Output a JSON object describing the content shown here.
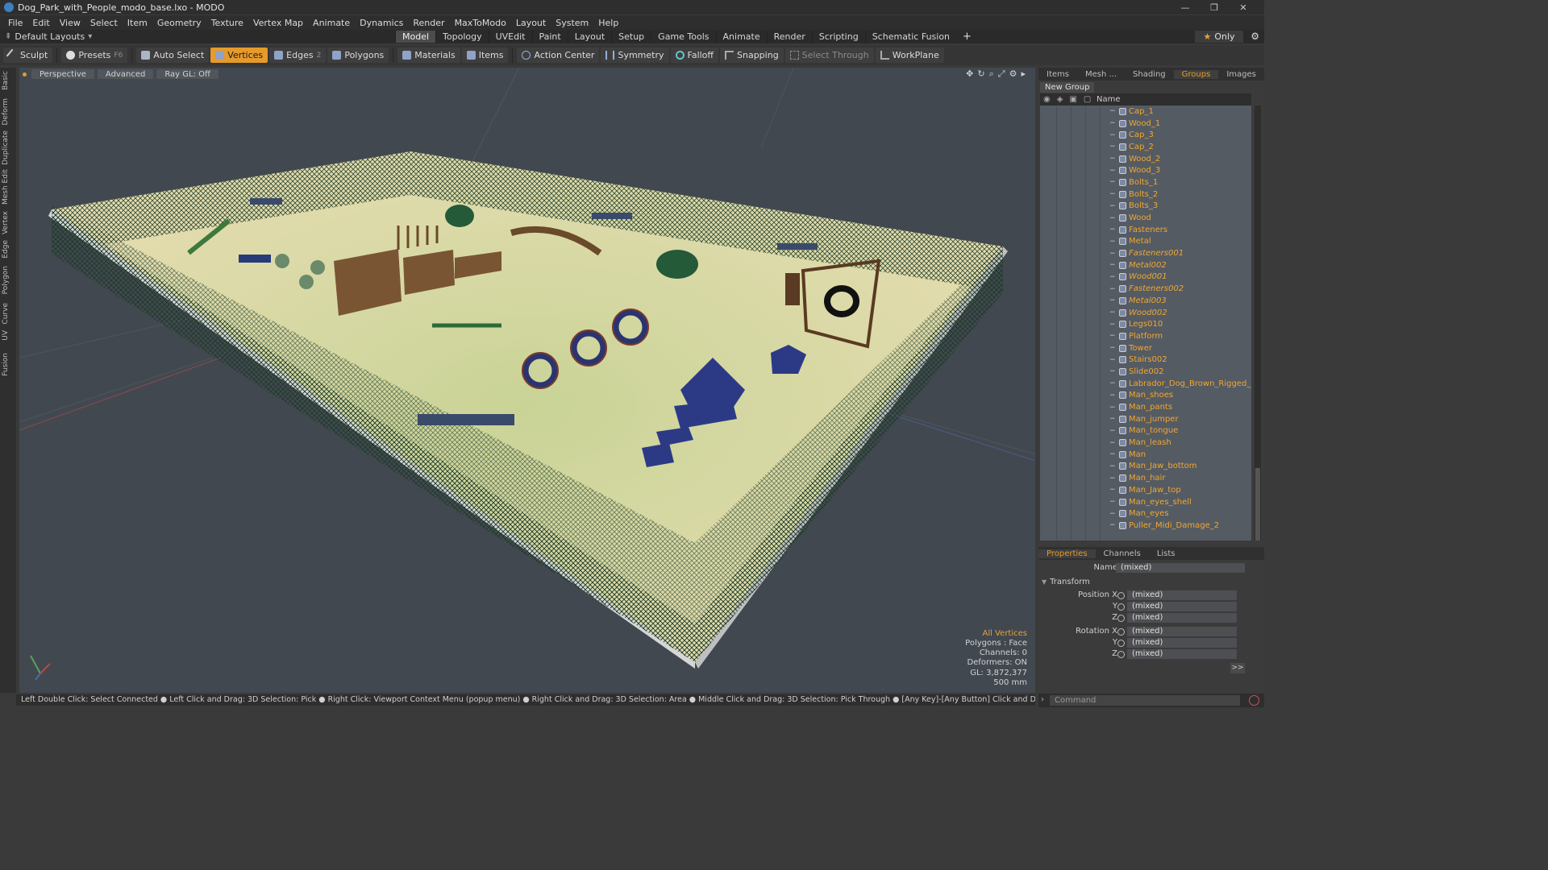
{
  "window": {
    "title": "Dog_Park_with_People_modo_base.lxo - MODO",
    "controls": [
      "—",
      "❐",
      "✕"
    ]
  },
  "menu": [
    "File",
    "Edit",
    "View",
    "Select",
    "Item",
    "Geometry",
    "Texture",
    "Vertex Map",
    "Animate",
    "Dynamics",
    "Render",
    "MaxToModo",
    "Layout",
    "System",
    "Help"
  ],
  "layout_bar": {
    "layouts_label": "Default Layouts",
    "tabs": [
      "Model",
      "Topology",
      "UVEdit",
      "Paint",
      "Layout",
      "Setup",
      "Game Tools",
      "Animate",
      "Render",
      "Scripting",
      "Schematic Fusion"
    ],
    "active_tab": "Model",
    "only_label": "Only"
  },
  "toolbar": {
    "sculpt": "Sculpt",
    "presets": "Presets",
    "presets_key": "F6",
    "auto_select": "Auto Select",
    "vertices": "Vertices",
    "edges": "Edges",
    "edges_count": "2",
    "polygons": "Polygons",
    "materials": "Materials",
    "items": "Items",
    "action_center": "Action Center",
    "symmetry": "Symmetry",
    "falloff": "Falloff",
    "snapping": "Snapping",
    "select_through": "Select Through",
    "workplane": "WorkPlane"
  },
  "left_tabs": [
    "Basic",
    "Deform",
    "Duplicate",
    "Mesh Edit",
    "Vertex",
    "Edge",
    "Polygon",
    "Curve",
    "UV",
    "Fusion"
  ],
  "viewport": {
    "view": "Perspective",
    "shading": "Advanced",
    "raygl": "Ray GL: Off",
    "stats": {
      "selection": "All Vertices",
      "polygons": "Polygons : Face",
      "channels": "Channels: 0",
      "deformers": "Deformers: ON",
      "gl": "GL: 3,872,377",
      "scale": "500 mm"
    }
  },
  "right_panel": {
    "tabs": [
      "Items",
      "Mesh ...",
      "Shading",
      "Groups",
      "Images"
    ],
    "active_tab": "Groups",
    "new_group": "New Group",
    "name_header": "Name",
    "groups": [
      {
        "name": "Cap_1",
        "italic": false
      },
      {
        "name": "Wood_1",
        "italic": false
      },
      {
        "name": "Cap_3",
        "italic": false
      },
      {
        "name": "Cap_2",
        "italic": false
      },
      {
        "name": "Wood_2",
        "italic": false
      },
      {
        "name": "Wood_3",
        "italic": false
      },
      {
        "name": "Bolts_1",
        "italic": false
      },
      {
        "name": "Bolts_2",
        "italic": false
      },
      {
        "name": "Bolts_3",
        "italic": false
      },
      {
        "name": "Wood",
        "italic": false
      },
      {
        "name": "Fasteners",
        "italic": false
      },
      {
        "name": "Metal",
        "italic": false
      },
      {
        "name": "Fasteners001",
        "italic": true
      },
      {
        "name": "Metal002",
        "italic": true
      },
      {
        "name": "Wood001",
        "italic": true
      },
      {
        "name": "Fasteners002",
        "italic": true
      },
      {
        "name": "Metal003",
        "italic": true
      },
      {
        "name": "Wood002",
        "italic": true
      },
      {
        "name": "Legs010",
        "italic": false
      },
      {
        "name": "Platform",
        "italic": false
      },
      {
        "name": "Tower",
        "italic": false
      },
      {
        "name": "Stairs002",
        "italic": false
      },
      {
        "name": "Slide002",
        "italic": false
      },
      {
        "name": "Labrador_Dog_Brown_Rigged_Fur",
        "italic": false
      },
      {
        "name": "Man_shoes",
        "italic": false
      },
      {
        "name": "Man_pants",
        "italic": false
      },
      {
        "name": "Man_jumper",
        "italic": false
      },
      {
        "name": "Man_tongue",
        "italic": false
      },
      {
        "name": "Man_leash",
        "italic": false
      },
      {
        "name": "Man",
        "italic": false
      },
      {
        "name": "Man_Jaw_bottom",
        "italic": false
      },
      {
        "name": "Man_hair",
        "italic": false
      },
      {
        "name": "Man_Jaw_top",
        "italic": false
      },
      {
        "name": "Man_eyes_shell",
        "italic": false
      },
      {
        "name": "Man_eyes",
        "italic": false
      },
      {
        "name": "Puller_Midi_Damage_2",
        "italic": false
      }
    ]
  },
  "properties": {
    "tabs": [
      "Properties",
      "Channels",
      "Lists"
    ],
    "active_tab": "Properties",
    "name_label": "Name",
    "name_value": "(mixed)",
    "section": "Transform",
    "position_label": "Position X",
    "rotation_label": "Rotation X",
    "y_label": "Y",
    "z_label": "Z",
    "mixed": "(mixed)",
    "more": ">>"
  },
  "statusbar": "Left Double Click: Select Connected ● Left Click and Drag: 3D Selection: Pick ● Right Click: Viewport Context Menu (popup menu) ● Right Click and Drag: 3D Selection: Area ● Middle Click and Drag: 3D Selection: Pick Through ● [Any Key]-[Any Button] Click and Drag: dragDropBegin",
  "command_placeholder": "Command",
  "colors": {
    "accent": "#e59a2c",
    "list_text": "#f0a731",
    "viewport_bg": "#424850",
    "fence": "#1f4a30",
    "ground": "#d8d8a0"
  }
}
